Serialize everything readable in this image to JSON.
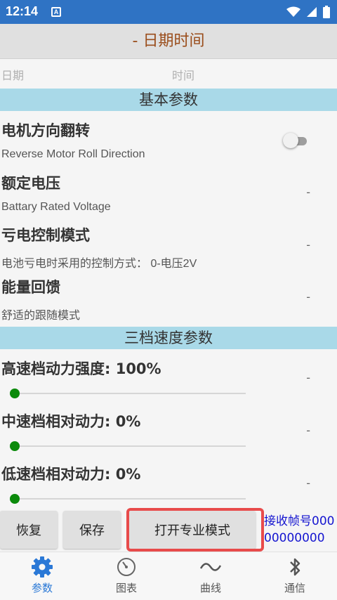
{
  "status_bar": {
    "time": "12:14",
    "notification_icon": "A",
    "icons": [
      "wifi-icon",
      "signal-icon",
      "battery-icon"
    ],
    "color": "#2f73c4"
  },
  "title_bar": {
    "title": "- 日期时间"
  },
  "datetime": {
    "date_label": "日期",
    "time_label": "时间"
  },
  "sections": {
    "basic": {
      "header": "基本参数",
      "items": [
        {
          "title": "电机方向翻转",
          "subtitle": "Reverse Motor Roll Direction",
          "value": "",
          "toggle_on": false
        },
        {
          "title": "额定电压",
          "subtitle": "Battary Rated Voltage",
          "value": "-"
        },
        {
          "title": "亏电控制模式",
          "subtitle": "电池亏电时采用的控制方式：  0-电压2V",
          "value": "-"
        },
        {
          "title": "能量回馈",
          "subtitle": "舒适的跟随模式",
          "value": "-"
        }
      ]
    },
    "speed": {
      "header": "三档速度参数",
      "items": [
        {
          "title": "高速档动力强度: 100%",
          "value": "-",
          "slider": 0
        },
        {
          "title": "中速档相对动力: 0%",
          "value": "-",
          "slider": 0
        },
        {
          "title": "低速档相对动力: 0%",
          "value": "-",
          "slider": 0
        }
      ]
    }
  },
  "actions": {
    "restore_label": "恢复",
    "save_label": "保存",
    "pro_mode_label": "打开专业模式",
    "highlight_color": "#e84b4b"
  },
  "frame_info": {
    "line1": "接收帧号000",
    "line2": "00000000"
  },
  "bottom_nav": {
    "items": [
      {
        "label": "参数",
        "icon": "gear-icon",
        "active": true
      },
      {
        "label": "图表",
        "icon": "gauge-icon",
        "active": false
      },
      {
        "label": "曲线",
        "icon": "wave-icon",
        "active": false
      },
      {
        "label": "通信",
        "icon": "bluetooth-icon",
        "active": false
      }
    ],
    "active_color": "#2a78d6"
  }
}
